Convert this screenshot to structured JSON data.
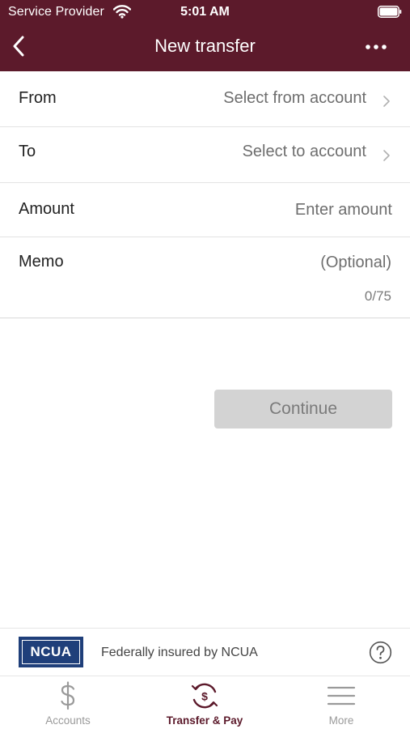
{
  "status_bar": {
    "carrier": "Service Provider",
    "time": "5:01 AM"
  },
  "nav": {
    "title": "New transfer",
    "back_icon": "chevron-left-icon",
    "more_icon": "ellipsis-icon"
  },
  "form": {
    "from": {
      "label": "From",
      "value": "Select from account"
    },
    "to": {
      "label": "To",
      "value": "Select to account"
    },
    "amount": {
      "label": "Amount",
      "placeholder": "Enter amount"
    },
    "memo": {
      "label": "Memo",
      "placeholder": "(Optional)",
      "char_count": "0/75"
    }
  },
  "continue_label": "Continue",
  "insured": {
    "logo_text": "NCUA",
    "text": "Federally insured by NCUA"
  },
  "tabs": [
    {
      "label": "Accounts",
      "icon": "dollar-icon",
      "active": false
    },
    {
      "label": "Transfer & Pay",
      "icon": "transfer-pay-icon",
      "active": true
    },
    {
      "label": "More",
      "icon": "hamburger-menu-icon",
      "active": false
    }
  ],
  "colors": {
    "header": "#5c1a2b",
    "active_tab": "#5c1a2b",
    "button_disabled": "#d3d3d3",
    "ncua_blue": "#1f3f7a"
  }
}
